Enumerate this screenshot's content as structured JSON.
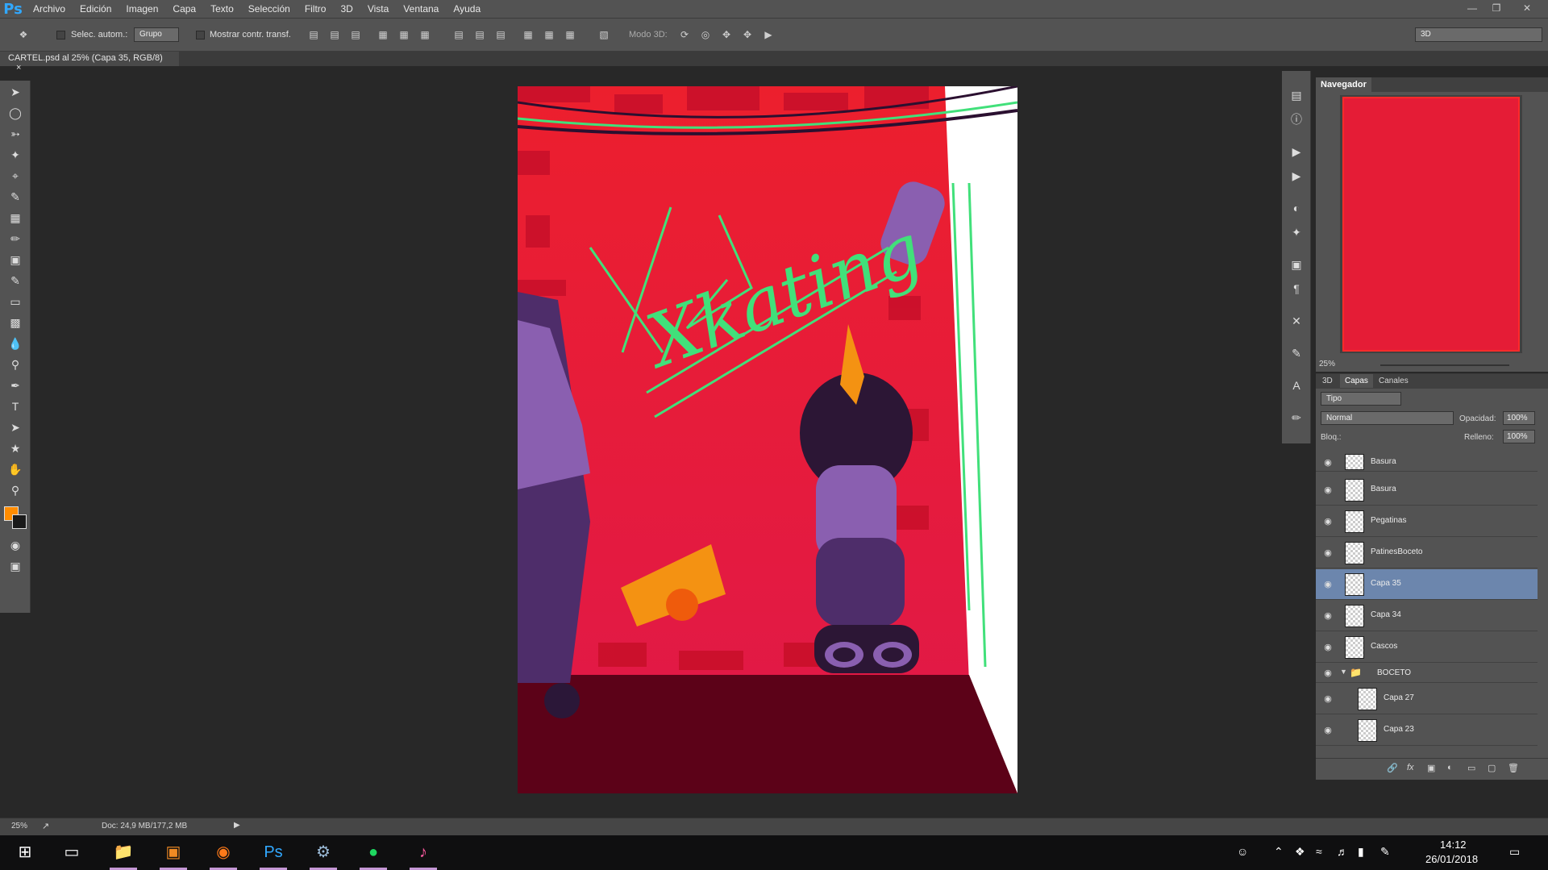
{
  "app": {
    "logo": "Ps",
    "menu": [
      "Archivo",
      "Edición",
      "Imagen",
      "Capa",
      "Texto",
      "Selección",
      "Filtro",
      "3D",
      "Vista",
      "Ventana",
      "Ayuda"
    ]
  },
  "options": {
    "auto_select_label": "Selec. autom.:",
    "auto_select_value": "Grupo",
    "show_transform_label": "Mostrar contr. transf.",
    "mode3d_label": "Modo 3D:",
    "workspace_value": "3D"
  },
  "document": {
    "tab_title": "CARTEL.psd al 25% (Capa 35, RGB/8)",
    "tab_close": "×",
    "artwork_text": "Xkating"
  },
  "colors": {
    "foreground": "#ff8c00",
    "background": "#1a1a1a",
    "selected_layer": "#6c86ad"
  },
  "navigator": {
    "title": "Navegador",
    "zoom": "25%"
  },
  "layers_panel": {
    "tabs": [
      "3D",
      "Capas",
      "Canales"
    ],
    "filter_value": "Tipo",
    "blend_mode": "Normal",
    "opacity_label": "Opacidad:",
    "opacity_value": "100%",
    "lock_label": "Bloq.:",
    "fill_label": "Relleno:",
    "fill_value": "100%",
    "layers": [
      {
        "name": "Basura"
      },
      {
        "name": "Basura"
      },
      {
        "name": "Pegatinas"
      },
      {
        "name": "PatinesBoceto"
      },
      {
        "name": "Capa 35"
      },
      {
        "name": "Capa 34"
      },
      {
        "name": "Cascos"
      },
      {
        "name": "BOCETO"
      },
      {
        "name": "Capa 27"
      },
      {
        "name": "Capa 23"
      }
    ]
  },
  "status": {
    "zoom": "25%",
    "doc_size": "Doc: 24,9 MB/177,2 MB"
  },
  "taskbar": {
    "time": "14:12",
    "date": "26/01/2018",
    "apps": [
      "task-view",
      "file-explorer",
      "sublime-text",
      "firefox",
      "photoshop",
      "steam",
      "spotify",
      "itunes"
    ]
  }
}
